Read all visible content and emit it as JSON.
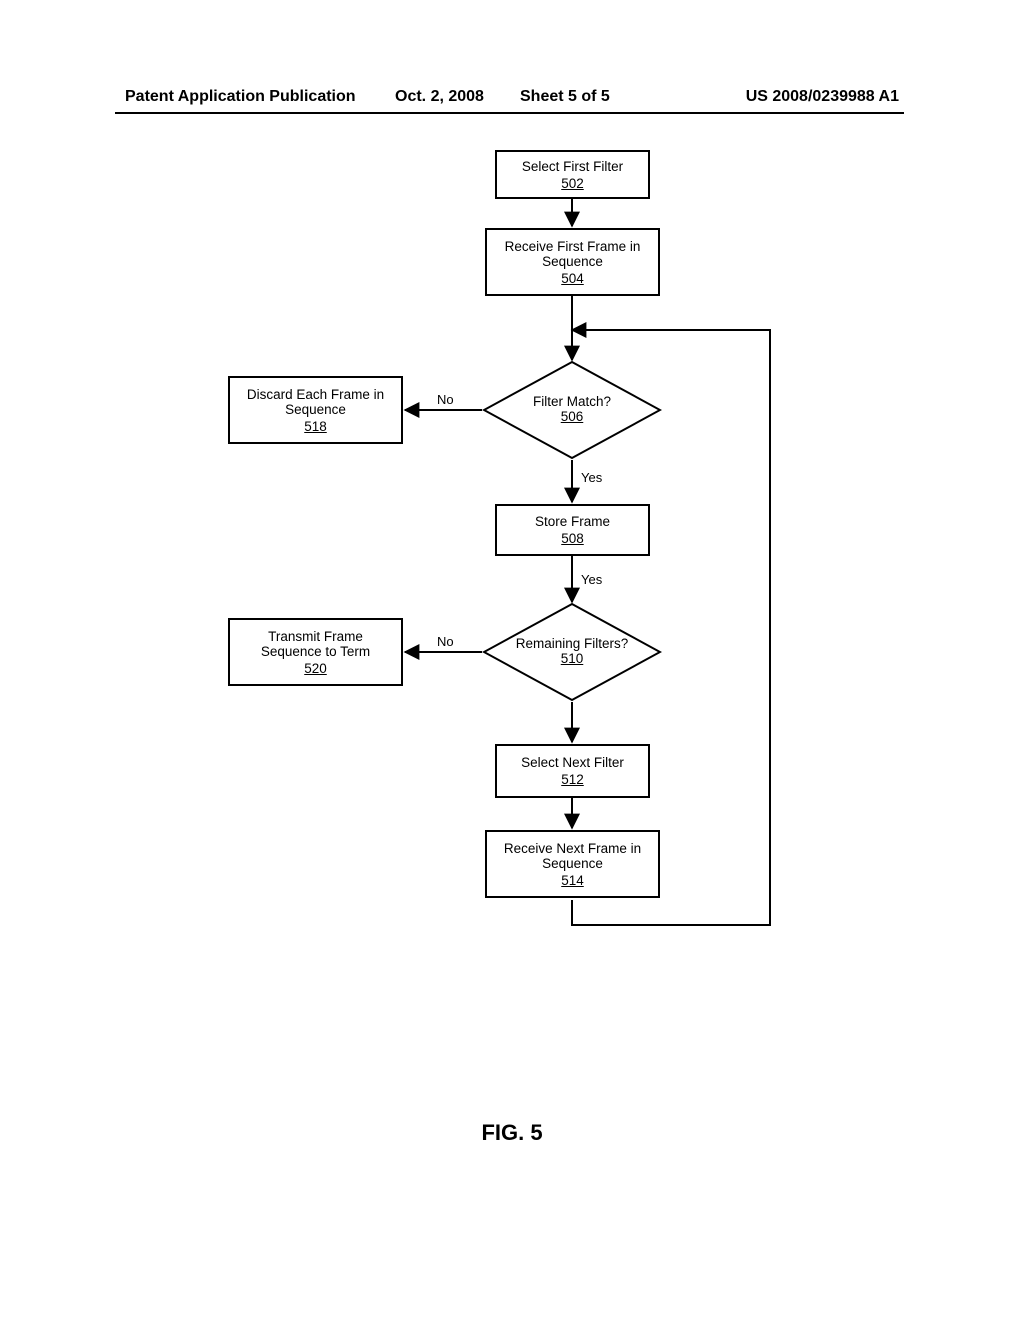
{
  "header": {
    "pub_label": "Patent Application Publication",
    "date": "Oct. 2, 2008",
    "sheet": "Sheet 5 of 5",
    "pub_number": "US 2008/0239988 A1"
  },
  "figure_caption": "FIG. 5",
  "nodes": {
    "n502": {
      "label": "Select First Filter",
      "num": "502"
    },
    "n504": {
      "label": "Receive First Frame in Sequence",
      "num": "504"
    },
    "n506": {
      "label": "Filter Match?",
      "num": "506"
    },
    "n508": {
      "label": "Store Frame",
      "num": "508"
    },
    "n510": {
      "label": "Remaining Filters?",
      "num": "510"
    },
    "n512": {
      "label": "Select Next Filter",
      "num": "512"
    },
    "n514": {
      "label": "Receive Next Frame in Sequence",
      "num": "514"
    },
    "n518": {
      "label": "Discard Each Frame in Sequence",
      "num": "518"
    },
    "n520": {
      "label": "Transmit Frame Sequence to Term",
      "num": "520"
    }
  },
  "edges": {
    "yes": "Yes",
    "no": "No"
  }
}
